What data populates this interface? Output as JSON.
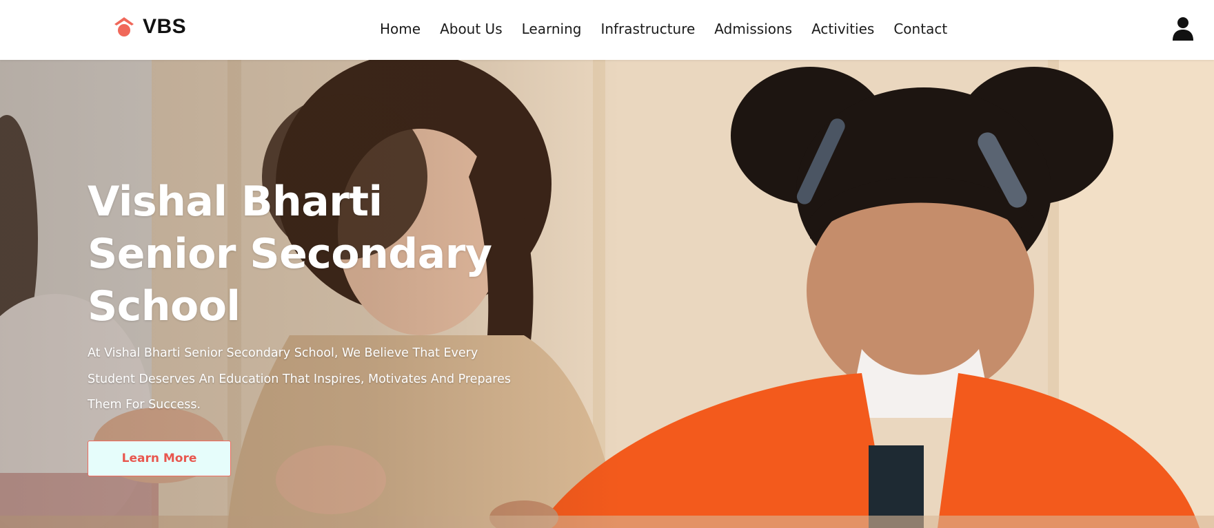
{
  "brand": {
    "name": "VBS",
    "icon": "graduation-cap-icon",
    "accent_color": "#f0685a"
  },
  "nav": {
    "items": [
      {
        "label": "Home"
      },
      {
        "label": "About Us"
      },
      {
        "label": "Learning"
      },
      {
        "label": "Infrastructure"
      },
      {
        "label": "Admissions"
      },
      {
        "label": "Activities"
      },
      {
        "label": "Contact"
      }
    ],
    "user_icon": "user-icon"
  },
  "hero": {
    "title": "Vishal Bharti Senior Secondary School",
    "description": "At Vishal Bharti Senior Secondary School, We Believe That Every Student Deserves An Education That Inspires, Motivates And Prepares Them For Success.",
    "button_label": "Learn More",
    "button_bg": "#e6fdfb",
    "button_text_color": "#e8574f"
  }
}
